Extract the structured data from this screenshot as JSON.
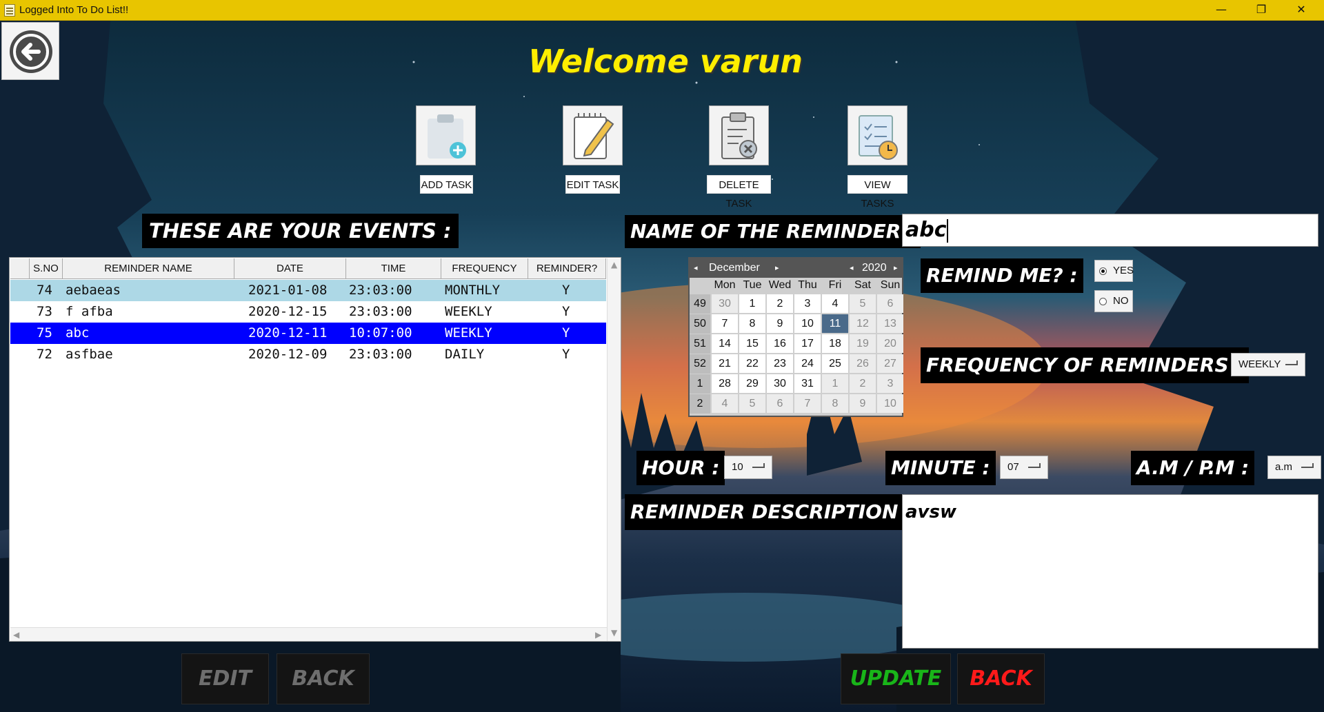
{
  "window": {
    "title": "Logged Into To Do List!!",
    "minimize": "—",
    "maximize": "❐",
    "close": "✕"
  },
  "welcome": "Welcome varun",
  "task_buttons": [
    {
      "label": "ADD TASK",
      "icon": "clipboard-add-icon"
    },
    {
      "label": "EDIT TASK",
      "icon": "notepad-pencil-icon"
    },
    {
      "label": "DELETE TASK",
      "icon": "clipboard-delete-icon"
    },
    {
      "label": "VIEW TASKS",
      "icon": "checklist-clock-icon"
    }
  ],
  "events_label": "THESE ARE YOUR EVENTS :",
  "table": {
    "columns": [
      "S.NO",
      "REMINDER NAME",
      "DATE",
      "TIME",
      "FREQUENCY",
      "REMINDER?"
    ],
    "rows": [
      {
        "sno": "74",
        "name": "aebaeas",
        "date": "2021-01-08",
        "time": "23:03:00",
        "frequency": "MONTHLY",
        "reminder": "Y"
      },
      {
        "sno": "73",
        "name": "f afba",
        "date": "2020-12-15",
        "time": "23:03:00",
        "frequency": "WEEKLY",
        "reminder": "Y"
      },
      {
        "sno": "75",
        "name": "abc",
        "date": "2020-12-11",
        "time": "10:07:00",
        "frequency": "WEEKLY",
        "reminder": "Y"
      },
      {
        "sno": "72",
        "name": "asfbae",
        "date": "2020-12-09",
        "time": "23:03:00",
        "frequency": "DAILY",
        "reminder": "Y"
      }
    ]
  },
  "form": {
    "name_label": "NAME OF THE REMINDER :",
    "name_value": "abc",
    "remind_label": "REMIND ME? :",
    "remind_yes": "YES",
    "remind_no": "NO",
    "frequency_label": "FREQUENCY OF REMINDERS :",
    "frequency_value": "WEEKLY",
    "hour_label": "HOUR :",
    "hour_value": "10",
    "minute_label": "MINUTE :",
    "minute_value": "07",
    "ampm_label": "A.M / P.M :",
    "ampm_value": "a.m",
    "desc_label": "REMINDER DESCRIPTION :",
    "desc_value": "avsw"
  },
  "calendar": {
    "month": "December",
    "year": "2020",
    "days_of_week": [
      "Mon",
      "Tue",
      "Wed",
      "Thu",
      "Fri",
      "Sat",
      "Sun"
    ],
    "weeks": [
      {
        "wk": "49",
        "days": [
          "30",
          "1",
          "2",
          "3",
          "4",
          "5",
          "6"
        ]
      },
      {
        "wk": "50",
        "days": [
          "7",
          "8",
          "9",
          "10",
          "11",
          "12",
          "13"
        ]
      },
      {
        "wk": "51",
        "days": [
          "14",
          "15",
          "16",
          "17",
          "18",
          "19",
          "20"
        ]
      },
      {
        "wk": "52",
        "days": [
          "21",
          "22",
          "23",
          "24",
          "25",
          "26",
          "27"
        ]
      },
      {
        "wk": "1",
        "days": [
          "28",
          "29",
          "30",
          "31",
          "1",
          "2",
          "3"
        ]
      },
      {
        "wk": "2",
        "days": [
          "4",
          "5",
          "6",
          "7",
          "8",
          "9",
          "10"
        ]
      }
    ],
    "selected_day": "11"
  },
  "buttons": {
    "edit": "EDIT",
    "back_left": "BACK",
    "update": "UPDATE",
    "back_right": "BACK"
  }
}
